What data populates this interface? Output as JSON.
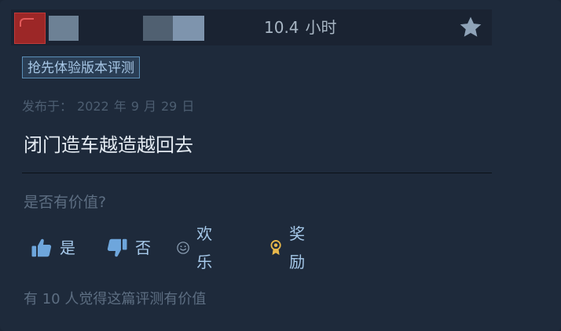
{
  "header": {
    "hours_value": "10.4",
    "hours_unit": "小时"
  },
  "badge": {
    "label": "抢先体验版本评测"
  },
  "posted": {
    "label": "发布于：",
    "year": "2022",
    "year_unit": "年",
    "month": "9",
    "month_unit": "月",
    "day": "29",
    "day_unit": "日"
  },
  "review": {
    "text": "闭门造车越造越回去"
  },
  "helpful": {
    "prompt": "是否有价值?",
    "yes_label": "是",
    "no_label": "否",
    "funny_label": "欢乐",
    "award_label": "奖励",
    "count_text": "有 10 人觉得这篇评测有价值"
  },
  "icons": {
    "thumbs_up": "thumbs-up-icon",
    "thumbs_down": "thumbs-down-icon",
    "funny": "smiley-icon",
    "award": "award-medal-icon",
    "favorite": "star-icon"
  },
  "colors": {
    "background": "#1e2a3b",
    "accent_text": "#a6c9ea",
    "muted_text": "#5d6e82",
    "badge_border": "#5b8fb8",
    "award_gold": "#e8b84b",
    "avatar_red": "#9c2727"
  }
}
